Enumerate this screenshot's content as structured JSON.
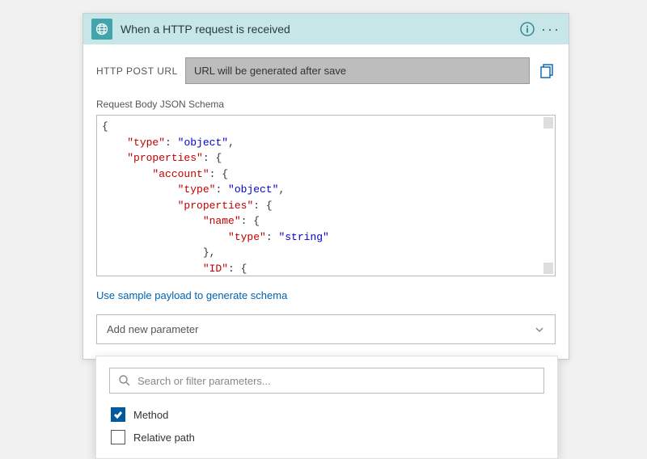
{
  "header": {
    "title": "When a HTTP request is received"
  },
  "postUrl": {
    "label": "HTTP POST URL",
    "value": "URL will be generated after save"
  },
  "schema": {
    "label": "Request Body JSON Schema",
    "lines": [
      {
        "indent": 0,
        "tokens": [
          {
            "t": "brace",
            "v": "{"
          }
        ]
      },
      {
        "indent": 1,
        "tokens": [
          {
            "t": "key",
            "v": "\"type\""
          },
          {
            "t": "punct",
            "v": ": "
          },
          {
            "t": "str",
            "v": "\"object\""
          },
          {
            "t": "punct",
            "v": ","
          }
        ]
      },
      {
        "indent": 1,
        "tokens": [
          {
            "t": "key",
            "v": "\"properties\""
          },
          {
            "t": "punct",
            "v": ": {"
          }
        ]
      },
      {
        "indent": 2,
        "tokens": [
          {
            "t": "key",
            "v": "\"account\""
          },
          {
            "t": "punct",
            "v": ": {"
          }
        ]
      },
      {
        "indent": 3,
        "tokens": [
          {
            "t": "key",
            "v": "\"type\""
          },
          {
            "t": "punct",
            "v": ": "
          },
          {
            "t": "str",
            "v": "\"object\""
          },
          {
            "t": "punct",
            "v": ","
          }
        ]
      },
      {
        "indent": 3,
        "tokens": [
          {
            "t": "key",
            "v": "\"properties\""
          },
          {
            "t": "punct",
            "v": ": {"
          }
        ]
      },
      {
        "indent": 4,
        "tokens": [
          {
            "t": "key",
            "v": "\"name\""
          },
          {
            "t": "punct",
            "v": ": {"
          }
        ]
      },
      {
        "indent": 5,
        "tokens": [
          {
            "t": "key",
            "v": "\"type\""
          },
          {
            "t": "punct",
            "v": ": "
          },
          {
            "t": "str",
            "v": "\"string\""
          }
        ]
      },
      {
        "indent": 4,
        "tokens": [
          {
            "t": "punct",
            "v": "},"
          }
        ]
      },
      {
        "indent": 4,
        "tokens": [
          {
            "t": "key",
            "v": "\"ID\""
          },
          {
            "t": "punct",
            "v": ": {"
          }
        ]
      }
    ]
  },
  "sampleLink": "Use sample payload to generate schema",
  "dropdown": {
    "placeholder": "Add new parameter"
  },
  "popup": {
    "searchPlaceholder": "Search or filter parameters...",
    "options": [
      {
        "label": "Method",
        "checked": true
      },
      {
        "label": "Relative path",
        "checked": false
      }
    ]
  }
}
